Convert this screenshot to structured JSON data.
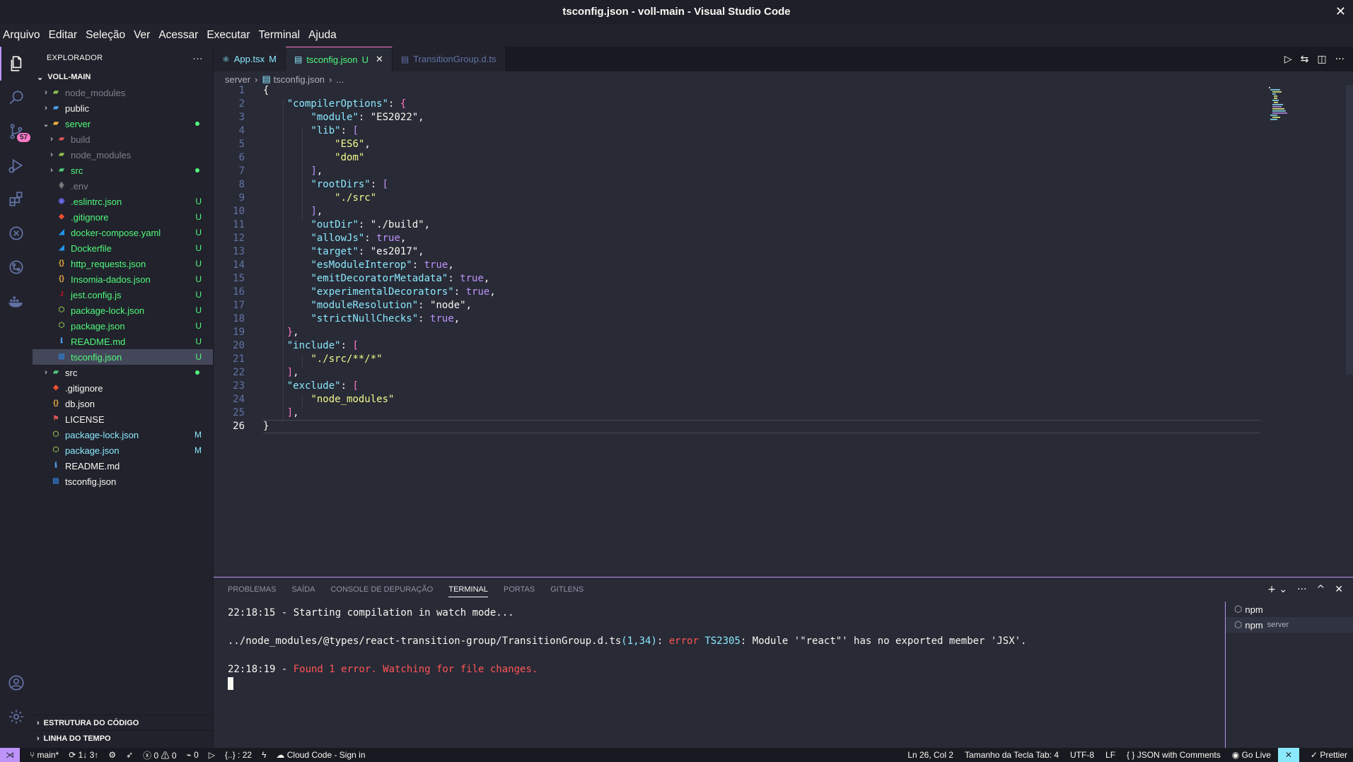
{
  "window": {
    "title": "tsconfig.json - voll-main - Visual Studio Code"
  },
  "menu": [
    "Arquivo",
    "Editar",
    "Seleção",
    "Ver",
    "Acessar",
    "Executar",
    "Terminal",
    "Ajuda"
  ],
  "activity": {
    "source_control_badge": "57"
  },
  "explorer": {
    "header": "EXPLORADOR",
    "root": "VOLL-MAIN",
    "items": [
      {
        "name": "node_modules",
        "type": "folder",
        "depth": 0,
        "collapsed": true,
        "color": "gray",
        "status": ""
      },
      {
        "name": "public",
        "type": "folder",
        "depth": 0,
        "collapsed": true,
        "color": "white",
        "status": ""
      },
      {
        "name": "server",
        "type": "folder",
        "depth": 0,
        "collapsed": false,
        "color": "green",
        "status": "dot"
      },
      {
        "name": "build",
        "type": "folder",
        "depth": 1,
        "collapsed": true,
        "color": "gray",
        "status": ""
      },
      {
        "name": "node_modules",
        "type": "folder",
        "depth": 1,
        "collapsed": true,
        "color": "gray",
        "status": ""
      },
      {
        "name": "src",
        "type": "folder",
        "depth": 1,
        "collapsed": true,
        "color": "green",
        "status": "dot"
      },
      {
        "name": ".env",
        "type": "file",
        "depth": 1,
        "color": "gray",
        "status": ""
      },
      {
        "name": ".eslintrc.json",
        "type": "file",
        "depth": 1,
        "color": "green",
        "status": "U"
      },
      {
        "name": ".gitignore",
        "type": "file",
        "depth": 1,
        "color": "green",
        "status": "U"
      },
      {
        "name": "docker-compose.yaml",
        "type": "file",
        "depth": 1,
        "color": "green",
        "status": "U"
      },
      {
        "name": "Dockerfile",
        "type": "file",
        "depth": 1,
        "color": "green",
        "status": "U"
      },
      {
        "name": "http_requests.json",
        "type": "file",
        "depth": 1,
        "color": "green",
        "status": "U"
      },
      {
        "name": "Insomia-dados.json",
        "type": "file",
        "depth": 1,
        "color": "green",
        "status": "U"
      },
      {
        "name": "jest.config.js",
        "type": "file",
        "depth": 1,
        "color": "green",
        "status": "U"
      },
      {
        "name": "package-lock.json",
        "type": "file",
        "depth": 1,
        "color": "green",
        "status": "U"
      },
      {
        "name": "package.json",
        "type": "file",
        "depth": 1,
        "color": "green",
        "status": "U"
      },
      {
        "name": "README.md",
        "type": "file",
        "depth": 1,
        "color": "green",
        "status": "U"
      },
      {
        "name": "tsconfig.json",
        "type": "file",
        "depth": 1,
        "color": "green",
        "status": "U",
        "selected": true
      },
      {
        "name": "src",
        "type": "folder",
        "depth": 0,
        "collapsed": true,
        "color": "white",
        "status": "dot"
      },
      {
        "name": ".gitignore",
        "type": "file",
        "depth": 0,
        "color": "white",
        "status": ""
      },
      {
        "name": "db.json",
        "type": "file",
        "depth": 0,
        "color": "white",
        "status": ""
      },
      {
        "name": "LICENSE",
        "type": "file",
        "depth": 0,
        "color": "white",
        "status": ""
      },
      {
        "name": "package-lock.json",
        "type": "file",
        "depth": 0,
        "color": "mod",
        "status": "M"
      },
      {
        "name": "package.json",
        "type": "file",
        "depth": 0,
        "color": "mod",
        "status": "M"
      },
      {
        "name": "README.md",
        "type": "file",
        "depth": 0,
        "color": "white",
        "status": ""
      },
      {
        "name": "tsconfig.json",
        "type": "file",
        "depth": 0,
        "color": "white",
        "status": ""
      }
    ],
    "outline": "ESTRUTURA DO CÓDIGO",
    "timeline": "LINHA DO TEMPO"
  },
  "tabs": [
    {
      "label": "App.tsx",
      "mark": "M",
      "active": false
    },
    {
      "label": "tsconfig.json",
      "mark": "U",
      "active": true
    },
    {
      "label": "TransitionGroup.d.ts",
      "mark": "",
      "active": false
    }
  ],
  "breadcrumb": [
    "server",
    "tsconfig.json",
    "..."
  ],
  "code": [
    "{",
    "    \"compilerOptions\": {",
    "        \"module\": \"ES2022\",",
    "        \"lib\": [",
    "            \"ES6\",",
    "            \"dom\"",
    "        ],",
    "        \"rootDirs\": [",
    "            \"./src\"",
    "        ],",
    "        \"outDir\": \"./build\",",
    "        \"allowJs\": true,",
    "        \"target\": \"es2017\",",
    "        \"esModuleInterop\": true,",
    "        \"emitDecoratorMetadata\": true,",
    "        \"experimentalDecorators\": true,",
    "        \"moduleResolution\": \"node\",",
    "        \"strictNullChecks\": true,",
    "    },",
    "    \"include\": [",
    "        \"./src/**/*\"",
    "    ],",
    "    \"exclude\": [",
    "        \"node_modules\"",
    "    ],",
    "}"
  ],
  "panel": {
    "tabs": [
      "PROBLEMAS",
      "SAÍDA",
      "CONSOLE DE DEPURAÇÃO",
      "TERMINAL",
      "PORTAS",
      "GITLENS"
    ],
    "active_tab": "TERMINAL",
    "terminal": {
      "line1": "22:18:15 - Starting compilation in watch mode...",
      "line2_path": "../node_modules/@types/react-transition-group/TransitionGroup.d.ts",
      "line2_loc": "(1,34)",
      "line2_sep": ": ",
      "line2_err": "error",
      "line2_code": " TS2305",
      "line2_msg": ": Module '\"react\"' has no exported member 'JSX'.",
      "line3_time": "22:18:19 - ",
      "line3_msg": "Found 1 error. Watching for file changes."
    },
    "terminals": [
      {
        "label": "npm",
        "sub": ""
      },
      {
        "label": "npm",
        "sub": "server"
      }
    ]
  },
  "statusbar": {
    "branch": "main*",
    "sync": "1↓ 3↑",
    "errors": "0",
    "warnings": "0",
    "ports": "0",
    "json_path": "{..} : 22",
    "cloud": "Cloud Code - Sign in",
    "position": "Ln 26, Col 2",
    "tab_size": "Tamanho da Tecla Tab: 4",
    "encoding": "UTF-8",
    "eol": "LF",
    "language": "JSON with Comments",
    "golive": "Go Live",
    "prettier": "Prettier"
  },
  "colors": {
    "background": "#282a36",
    "accent": "#bd93f9",
    "string": "#f1fa8c",
    "key": "#8be9fd",
    "error": "#ff5555",
    "untracked": "#50fa7b"
  }
}
